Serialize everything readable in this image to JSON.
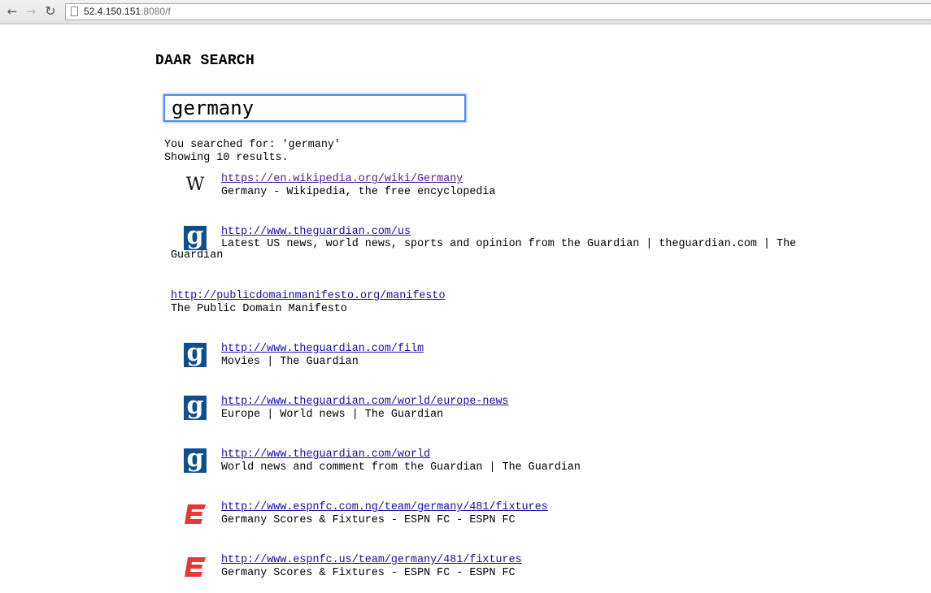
{
  "browser": {
    "url_host": "52.4.150.151",
    "url_rest": ":8080/f"
  },
  "page": {
    "title": "DAAR SEARCH",
    "search_value": "germany",
    "searched_for": "You searched for: 'germany'",
    "showing": "Showing 10 results."
  },
  "results": [
    {
      "icon": "wikipedia-icon",
      "url": "https://en.wikipedia.org/wiki/Germany",
      "desc": "Germany - Wikipedia, the free encyclopedia",
      "visited": true
    },
    {
      "icon": "guardian-icon",
      "url": "http://www.theguardian.com/us",
      "desc": "Latest US news, world news, sports and opinion from the Guardian | theguardian.com | The Guardian"
    },
    {
      "icon": "",
      "url": "http://publicdomainmanifesto.org/manifesto",
      "desc": "The Public Domain Manifesto"
    },
    {
      "icon": "guardian-icon",
      "url": "http://www.theguardian.com/film",
      "desc": "Movies | The Guardian"
    },
    {
      "icon": "guardian-icon",
      "url": "http://www.theguardian.com/world/europe-news",
      "desc": "Europe | World news | The Guardian"
    },
    {
      "icon": "guardian-icon",
      "url": "http://www.theguardian.com/world",
      "desc": "World news and comment from the Guardian | The Guardian"
    },
    {
      "icon": "espn-icon",
      "url": "http://www.espnfc.com.ng/team/germany/481/fixtures",
      "desc": "Germany Scores & Fixtures - ESPN FC - ESPN FC"
    },
    {
      "icon": "espn-icon",
      "url": "http://www.espnfc.us/team/germany/481/fixtures",
      "desc": "Germany Scores & Fixtures - ESPN FC - ESPN FC"
    }
  ],
  "colors": {
    "link": "#1a0dab",
    "visited": "#551a8b",
    "guardian_blue": "#0e4f8b",
    "espn_red": "#e53935"
  }
}
